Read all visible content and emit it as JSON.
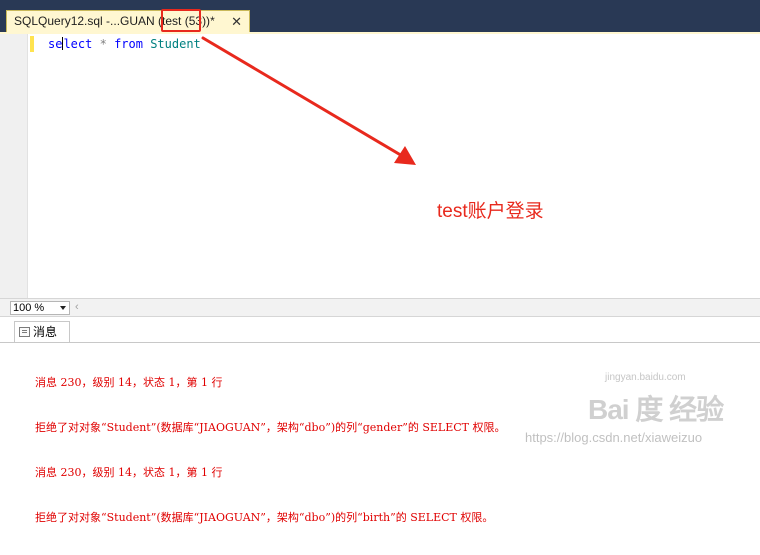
{
  "tab": {
    "title_prefix": "SQLQuery12.sql -...GUAN ",
    "title_highlight": "(test (53))",
    "title_suffix": "*",
    "close_glyph": "✕"
  },
  "editor": {
    "code_pre": "se",
    "code_post": "lect",
    "op": "*",
    "kw_from": "from",
    "table": "Student"
  },
  "annotation": {
    "text": "test账户登录"
  },
  "zoom": {
    "value": "100 %"
  },
  "results": {
    "tab_label": "消息",
    "messages": [
      "消息 230，级别 14，状态 1，第 1 行",
      "拒绝了对对象“Student”(数据库“JIAOGUAN”，架构“dbo”)的列“gender”的 SELECT 权限。",
      "消息 230，级别 14，状态 1，第 1 行",
      "拒绝了对对象“Student”(数据库“JIAOGUAN”，架构“dbo”)的列“birth”的 SELECT 权限。"
    ]
  },
  "watermark": {
    "logo": "Bai 度 经验",
    "sub": "jingyan.baidu.com",
    "url": "https://blog.csdn.net/xiaweizuo"
  },
  "colors": {
    "annotation": "#e8291d",
    "error_text": "#e00000",
    "tab_bg": "#fff7d1"
  }
}
